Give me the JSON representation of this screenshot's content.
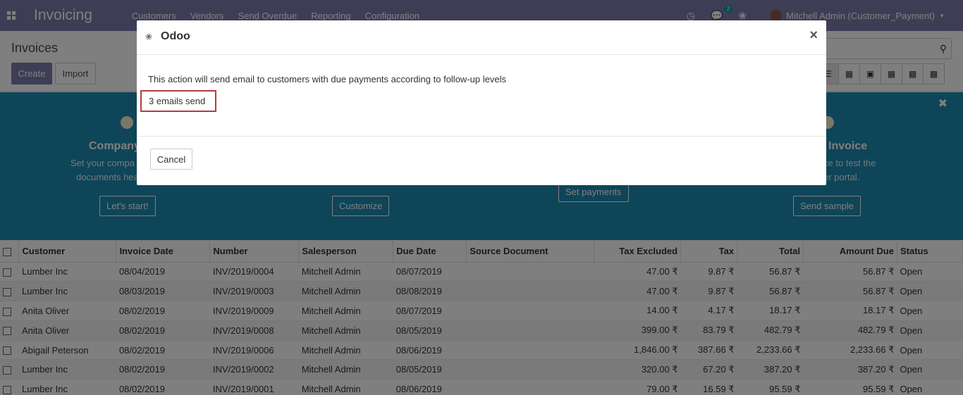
{
  "navbar": {
    "brand": "Invoicing",
    "menu": [
      "Customers",
      "Vendors",
      "Send Overdue",
      "Reporting",
      "Configuration"
    ],
    "messages_badge": "2",
    "user": "Mitchell Admin (Customer_Payment)"
  },
  "control_panel": {
    "title": "Invoices",
    "create_label": "Create",
    "import_label": "Import"
  },
  "banner": {
    "step1_title": "Company",
    "step1_text1": "Set your compa",
    "step1_text2": "documents hea",
    "step1_button": "Let's start!",
    "step2_button": "Customize",
    "step3_button": "Set payments",
    "step4_title": "Invoice",
    "step4_text1": "ce to test the",
    "step4_text2": "er portal.",
    "step4_button": "Send sample"
  },
  "table": {
    "headers": {
      "customer": "Customer",
      "invoice_date": "Invoice Date",
      "number": "Number",
      "salesperson": "Salesperson",
      "due_date": "Due Date",
      "source_document": "Source Document",
      "tax_excluded": "Tax Excluded",
      "tax": "Tax",
      "total": "Total",
      "amount_due": "Amount Due",
      "status": "Status"
    },
    "rows": [
      {
        "customer": "Lumber Inc",
        "invoice_date": "08/04/2019",
        "number": "INV/2019/0004",
        "salesperson": "Mitchell Admin",
        "due_date": "08/07/2019",
        "tax_excluded": "47.00 ₹",
        "tax": "9.87 ₹",
        "total": "56.87 ₹",
        "amount_due": "56.87 ₹",
        "status": "Open"
      },
      {
        "customer": "Lumber Inc",
        "invoice_date": "08/03/2019",
        "number": "INV/2019/0003",
        "salesperson": "Mitchell Admin",
        "due_date": "08/08/2019",
        "tax_excluded": "47.00 ₹",
        "tax": "9.87 ₹",
        "total": "56.87 ₹",
        "amount_due": "56.87 ₹",
        "status": "Open"
      },
      {
        "customer": "Anita Oliver",
        "invoice_date": "08/02/2019",
        "number": "INV/2019/0009",
        "salesperson": "Mitchell Admin",
        "due_date": "08/07/2019",
        "tax_excluded": "14.00 ₹",
        "tax": "4.17 ₹",
        "total": "18.17 ₹",
        "amount_due": "18.17 ₹",
        "status": "Open"
      },
      {
        "customer": "Anita Oliver",
        "invoice_date": "08/02/2019",
        "number": "INV/2019/0008",
        "salesperson": "Mitchell Admin",
        "due_date": "08/05/2019",
        "tax_excluded": "399.00 ₹",
        "tax": "83.79 ₹",
        "total": "482.79 ₹",
        "amount_due": "482.79 ₹",
        "status": "Open"
      },
      {
        "customer": "Abigail Peterson",
        "invoice_date": "08/02/2019",
        "number": "INV/2019/0006",
        "salesperson": "Mitchell Admin",
        "due_date": "08/06/2019",
        "tax_excluded": "1,846.00 ₹",
        "tax": "387.66 ₹",
        "total": "2,233.66 ₹",
        "amount_due": "2,233.66 ₹",
        "status": "Open"
      },
      {
        "customer": "Lumber Inc",
        "invoice_date": "08/02/2019",
        "number": "INV/2019/0002",
        "salesperson": "Mitchell Admin",
        "due_date": "08/05/2019",
        "tax_excluded": "320.00 ₹",
        "tax": "67.20 ₹",
        "total": "387.20 ₹",
        "amount_due": "387.20 ₹",
        "status": "Open"
      },
      {
        "customer": "Lumber Inc",
        "invoice_date": "08/02/2019",
        "number": "INV/2019/0001",
        "salesperson": "Mitchell Admin",
        "due_date": "08/06/2019",
        "tax_excluded": "79.00 ₹",
        "tax": "16.59 ₹",
        "total": "95.59 ₹",
        "amount_due": "95.59 ₹",
        "status": "Open"
      }
    ]
  },
  "modal": {
    "title": "Odoo",
    "close_glyph": "×",
    "message": "This action will send email to customers with due payments according to follow-up levels",
    "result": "3 emails send",
    "cancel_label": "Cancel"
  },
  "colors": {
    "navbar": "#7c7bad",
    "banner": "#1f8ab1",
    "highlight_border": "#b53a44"
  }
}
